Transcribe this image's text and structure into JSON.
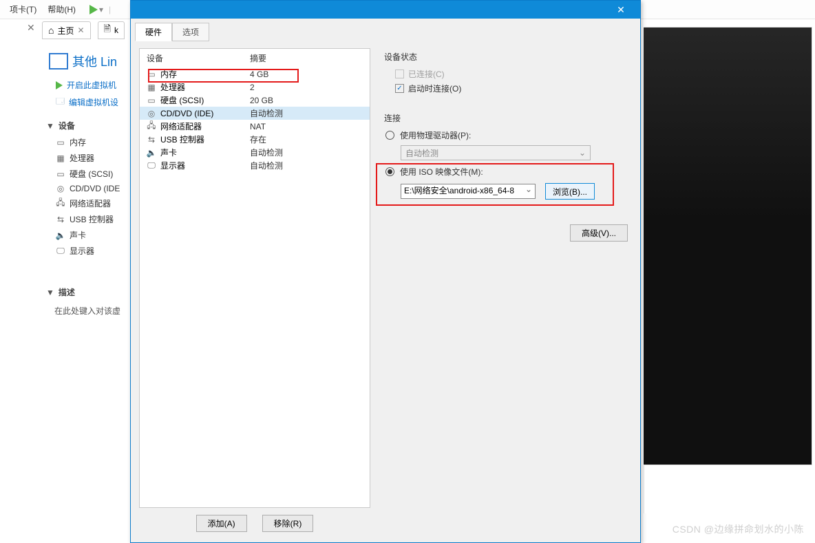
{
  "top_menu": {
    "tab_card": "项卡(T)",
    "help": "帮助(H)"
  },
  "tabbar": {
    "home": "主页",
    "tab2": "k"
  },
  "vm": {
    "title": "其他 Lin",
    "start": "开启此虚拟机",
    "edit": "编辑虚拟机设"
  },
  "tree": {
    "devices_header": "设备",
    "items": [
      "内存",
      "处理器",
      "硬盘 (SCSI)",
      "CD/DVD (IDE",
      "网络适配器",
      "USB 控制器",
      "声卡",
      "显示器"
    ],
    "desc_header": "描述",
    "desc_text": "在此处键入对该虚"
  },
  "dialog": {
    "title": "",
    "tabs": {
      "hardware": "硬件",
      "options": "选项"
    },
    "hw_head": {
      "device": "设备",
      "summary": "摘要"
    },
    "hw_rows": [
      {
        "name": "内存",
        "summary": "4 GB",
        "icon": "memory-icon"
      },
      {
        "name": "处理器",
        "summary": "2",
        "icon": "cpu-icon"
      },
      {
        "name": "硬盘 (SCSI)",
        "summary": "20 GB",
        "icon": "disk-icon"
      },
      {
        "name": "CD/DVD (IDE)",
        "summary": "自动检测",
        "icon": "cd-icon"
      },
      {
        "name": "网络适配器",
        "summary": "NAT",
        "icon": "net-icon"
      },
      {
        "name": "USB 控制器",
        "summary": "存在",
        "icon": "usb-icon"
      },
      {
        "name": "声卡",
        "summary": "自动检测",
        "icon": "sound-icon"
      },
      {
        "name": "显示器",
        "summary": "自动检测",
        "icon": "display-icon"
      }
    ],
    "add_btn": "添加(A)",
    "remove_btn": "移除(R)",
    "status_header": "设备状态",
    "connected": "已连接(C)",
    "connect_power": "启动时连接(O)",
    "conn_header": "连接",
    "use_physical": "使用物理驱动器(P):",
    "auto_detect": "自动检测",
    "use_iso": "使用 ISO 映像文件(M):",
    "iso_path": "E:\\网络安全\\android-x86_64-8",
    "browse": "浏览(B)...",
    "advanced": "高级(V)..."
  },
  "watermark": "CSDN @边缘拼命划水的小陈"
}
